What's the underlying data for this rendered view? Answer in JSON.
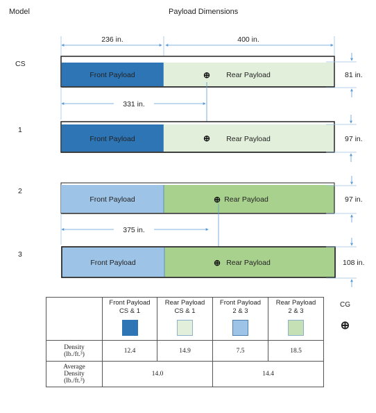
{
  "header": {
    "model_label": "Model",
    "title": "Payload Dimensions"
  },
  "colors": {
    "front_cs1": "#2e75b6",
    "rear_cs1": "#e2efda",
    "front_23": "#9dc3e6",
    "rear_23": "#a9d18e",
    "dimension_line": "#5b9bd5",
    "outline": "#222222"
  },
  "dimensions": {
    "front_length": "236 in.",
    "rear_length": "400 in.",
    "cg_cs1": "331 in.",
    "cg_23": "375 in."
  },
  "models": [
    {
      "label": "CS",
      "front_label": "Front Payload",
      "rear_label": "Rear Payload",
      "height": "81 in."
    },
    {
      "label": "1",
      "front_label": "Front Payload",
      "rear_label": "Rear Payload",
      "height": "97 in."
    },
    {
      "label": "2",
      "front_label": "Front Payload",
      "rear_label": "Rear Payload",
      "height": "97 in."
    },
    {
      "label": "3",
      "front_label": "Front Payload",
      "rear_label": "Rear Payload",
      "height": "108 in."
    }
  ],
  "cg_symbol": "⊕",
  "table": {
    "columns": [
      {
        "line1": "Front Payload",
        "line2": "CS & 1"
      },
      {
        "line1": "Rear Payload",
        "line2": "CS & 1"
      },
      {
        "line1": "Front Payload",
        "line2": "2 & 3"
      },
      {
        "line1": "Rear Payload",
        "line2": "2 & 3"
      }
    ],
    "density_label_line1": "Density",
    "density_label_line2": "(lb./ft.³)",
    "density_values": [
      "12.4",
      "14.9",
      "7.5",
      "18.5"
    ],
    "avg_label_line1": "Average",
    "avg_label_line2": "Density",
    "avg_label_line3": "(lb./ft.³)",
    "avg_values": [
      "14.0",
      "14.4"
    ]
  },
  "cg_legend": {
    "label": "CG",
    "symbol": "⊕"
  }
}
